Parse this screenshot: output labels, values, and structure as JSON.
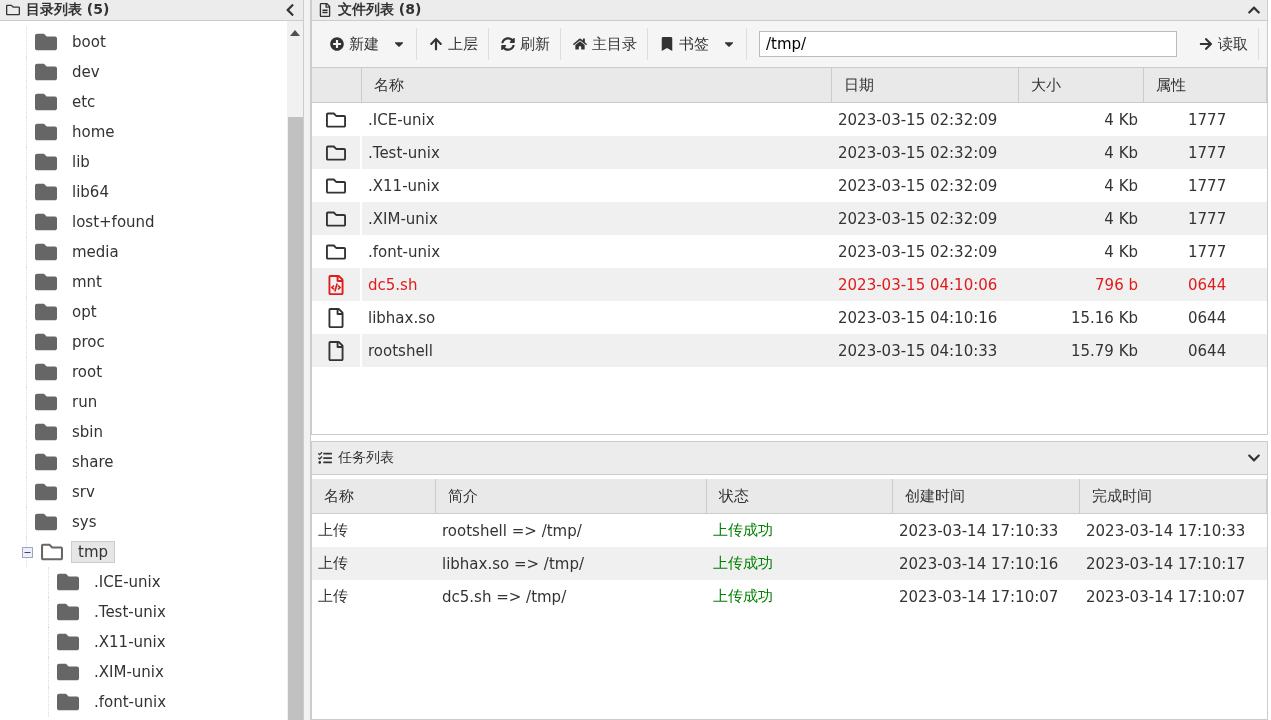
{
  "tree_panel": {
    "title": "目录列表 (5)",
    "items": [
      {
        "label": "boot",
        "selected": false
      },
      {
        "label": "dev",
        "selected": false
      },
      {
        "label": "etc",
        "selected": false
      },
      {
        "label": "home",
        "selected": false
      },
      {
        "label": "lib",
        "selected": false
      },
      {
        "label": "lib64",
        "selected": false
      },
      {
        "label": "lost+found",
        "selected": false
      },
      {
        "label": "media",
        "selected": false
      },
      {
        "label": "mnt",
        "selected": false
      },
      {
        "label": "opt",
        "selected": false
      },
      {
        "label": "proc",
        "selected": false
      },
      {
        "label": "root",
        "selected": false
      },
      {
        "label": "run",
        "selected": false
      },
      {
        "label": "sbin",
        "selected": false
      },
      {
        "label": "share",
        "selected": false
      },
      {
        "label": "srv",
        "selected": false
      },
      {
        "label": "sys",
        "selected": false
      },
      {
        "label": "tmp",
        "selected": true,
        "expanded": true,
        "children": [
          {
            "label": ".ICE-unix",
            "selected": false
          },
          {
            "label": ".Test-unix",
            "selected": false
          },
          {
            "label": ".X11-unix",
            "selected": false
          },
          {
            "label": ".XIM-unix",
            "selected": false
          },
          {
            "label": ".font-unix",
            "selected": false
          }
        ]
      }
    ]
  },
  "file_panel": {
    "title": "文件列表 (8)",
    "toolbar": [
      {
        "label": "新建",
        "kind": "new",
        "dropdown": true
      },
      {
        "label": "上层",
        "kind": "up",
        "dropdown": false
      },
      {
        "label": "刷新",
        "kind": "refresh",
        "dropdown": false
      },
      {
        "label": "主目录",
        "kind": "home",
        "dropdown": false
      },
      {
        "label": "书签",
        "kind": "bookmark",
        "dropdown": true
      }
    ],
    "path": "/tmp/",
    "read_button": "读取",
    "columns": [
      "名称",
      "日期",
      "大小",
      "属性"
    ],
    "rows": [
      {
        "kind": "folder",
        "name": ".ICE-unix",
        "date": "2023-03-15 02:32:09",
        "size": "4 Kb",
        "mode": "1777"
      },
      {
        "kind": "folder",
        "name": ".Test-unix",
        "date": "2023-03-15 02:32:09",
        "size": "4 Kb",
        "mode": "1777"
      },
      {
        "kind": "folder",
        "name": ".X11-unix",
        "date": "2023-03-15 02:32:09",
        "size": "4 Kb",
        "mode": "1777"
      },
      {
        "kind": "folder",
        "name": ".XIM-unix",
        "date": "2023-03-15 02:32:09",
        "size": "4 Kb",
        "mode": "1777"
      },
      {
        "kind": "folder",
        "name": ".font-unix",
        "date": "2023-03-15 02:32:09",
        "size": "4 Kb",
        "mode": "1777"
      },
      {
        "kind": "script",
        "name": "dc5.sh",
        "date": "2023-03-15 04:10:06",
        "size": "796 b",
        "mode": "0644"
      },
      {
        "kind": "file",
        "name": "libhax.so",
        "date": "2023-03-15 04:10:16",
        "size": "15.16 Kb",
        "mode": "0644"
      },
      {
        "kind": "file",
        "name": "rootshell",
        "date": "2023-03-15 04:10:33",
        "size": "15.79 Kb",
        "mode": "0644"
      }
    ]
  },
  "task_panel": {
    "title": "任务列表",
    "columns": [
      "名称",
      "简介",
      "状态",
      "创建时间",
      "完成时间"
    ],
    "rows": [
      {
        "name": "上传",
        "summary": "rootshell => /tmp/",
        "status": "上传成功",
        "created": "2023-03-14 17:10:33",
        "finished": "2023-03-14 17:10:33"
      },
      {
        "name": "上传",
        "summary": "libhax.so => /tmp/",
        "status": "上传成功",
        "created": "2023-03-14 17:10:16",
        "finished": "2023-03-14 17:10:17"
      },
      {
        "name": "上传",
        "summary": "dc5.sh => /tmp/",
        "status": "上传成功",
        "created": "2023-03-14 17:10:07",
        "finished": "2023-03-14 17:10:07"
      }
    ]
  }
}
